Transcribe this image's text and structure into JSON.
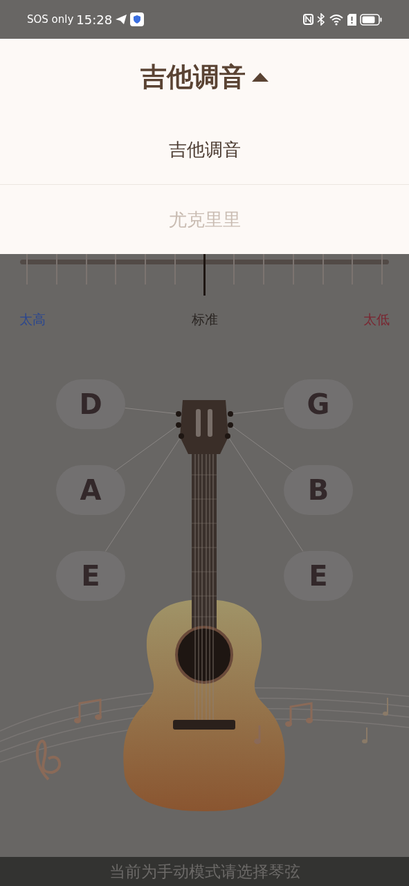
{
  "status_bar": {
    "carrier": "SOS only",
    "time": "15:28"
  },
  "header": {
    "title": "吉他调音",
    "expanded": true
  },
  "menu": [
    {
      "label": "吉他调音",
      "selected": true
    },
    {
      "label": "尤克里里",
      "selected": false
    }
  ],
  "tuner": {
    "level": 0.5,
    "labels": [
      "太高",
      "标准",
      "太低"
    ]
  },
  "strings": [
    {
      "note": "D"
    },
    {
      "note": "G"
    },
    {
      "note": "A"
    },
    {
      "note": "B"
    },
    {
      "note": "E"
    },
    {
      "note": "E"
    }
  ],
  "footer": {
    "hint": "当前为手动模式请选择琴弦"
  }
}
